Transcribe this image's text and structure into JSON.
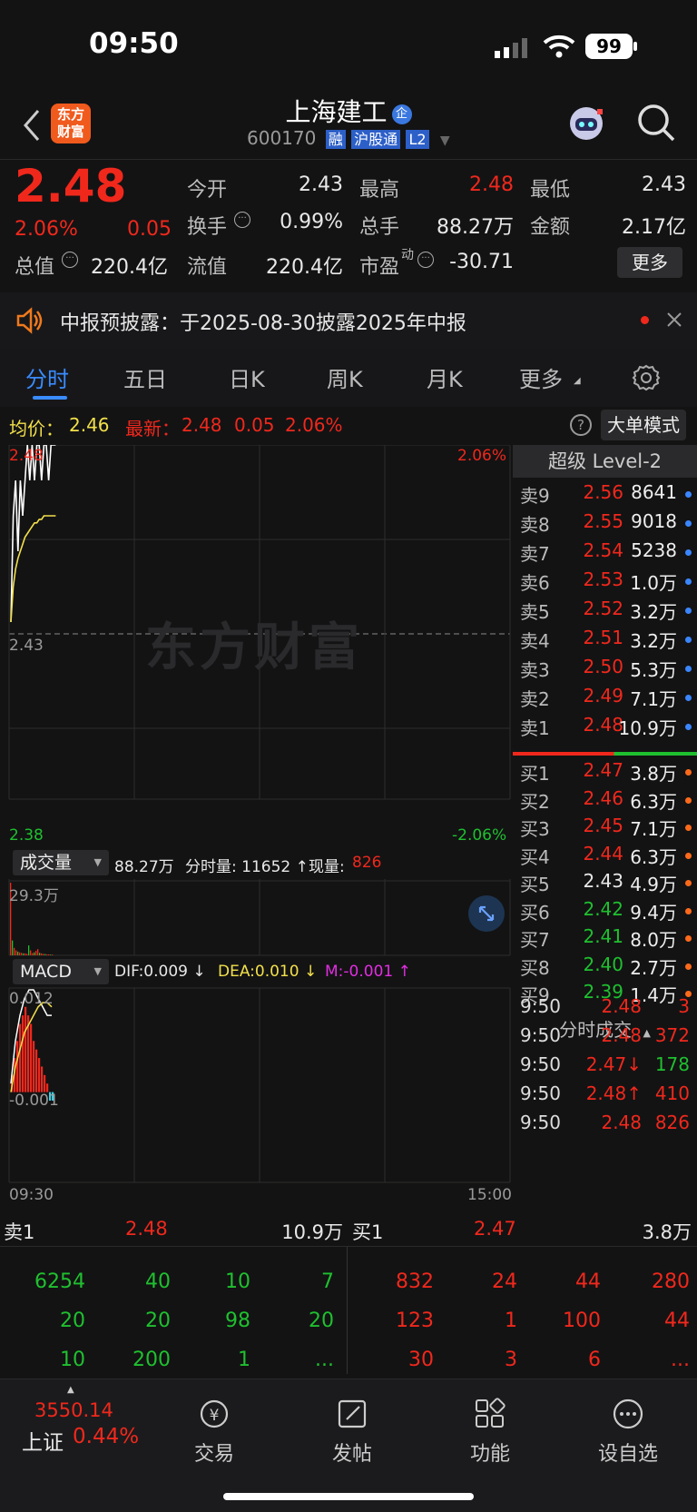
{
  "status_bar": {
    "time": "09:50",
    "battery": "99"
  },
  "header": {
    "logo_text_1": "东方",
    "logo_text_2": "财富",
    "stock_name": "上海建工",
    "badge_qi": "企",
    "stock_code": "600170",
    "tags": [
      "融",
      "沪股通",
      "L2"
    ]
  },
  "quote": {
    "price": "2.48",
    "change_pct": "2.06%",
    "change": "0.05",
    "fields": [
      {
        "k": "今开",
        "v": "2.43"
      },
      {
        "k": "最高",
        "v": "2.48"
      },
      {
        "k": "最低",
        "v": "2.43"
      },
      {
        "k": "换手",
        "v": "0.99%"
      },
      {
        "k": "总手",
        "v": "88.27万"
      },
      {
        "k": "金额",
        "v": "2.17亿"
      },
      {
        "k": "总值",
        "v": "220.4亿"
      },
      {
        "k": "流值",
        "v": "220.4亿"
      },
      {
        "k": "市盈",
        "v": "-30.71"
      }
    ],
    "pe_superscript": "动",
    "more_button": "更多"
  },
  "notice": {
    "text": "中报预披露：于2025-08-30披露2025年中报"
  },
  "tabs": [
    "分时",
    "五日",
    "日K",
    "周K",
    "月K",
    "更多"
  ],
  "info_bar": {
    "avg_label": "均价：",
    "avg_value": "2.46",
    "latest_label": "最新：",
    "latest_price": "2.48",
    "latest_change": "0.05",
    "latest_pct": "2.06%",
    "big_order_button": "大单模式"
  },
  "chart_labels": {
    "top_left": "2.48",
    "top_right": "2.06%",
    "mid_left": "2.43",
    "bottom_left": "2.38",
    "bottom_right": "-2.06%",
    "watermark": "东方财富",
    "volume_selector": "成交量",
    "volume_total": "88.27万",
    "volume_fen_label": "分时量: 11652 ↑",
    "volume_now_label": "现量:",
    "volume_now_value": "826",
    "volume_max": "29.3万",
    "macd_selector": "MACD",
    "dif": "DIF:0.009 ↓",
    "dea": "DEA:0.010 ↓",
    "m": "M:-0.001 ↑",
    "macd_top": "0.012",
    "macd_bottom": "-0.001",
    "time_start": "09:30",
    "time_end": "15:00"
  },
  "chart_data": {
    "type": "line",
    "ylim": [
      2.38,
      2.48
    ],
    "price_series": [
      2.43,
      2.46,
      2.47,
      2.45,
      2.47,
      2.46,
      2.47,
      2.48,
      2.47,
      2.48,
      2.47,
      2.48,
      2.48,
      2.47,
      2.48,
      2.48,
      2.47,
      2.48,
      2.48,
      2.48
    ],
    "avg_series": [
      2.43,
      2.44,
      2.445,
      2.448,
      2.45,
      2.452,
      2.454,
      2.455,
      2.456,
      2.457,
      2.458,
      2.458,
      2.459,
      2.459,
      2.46,
      2.46,
      2.46,
      2.46,
      2.46,
      2.46
    ],
    "volume_max": 293000,
    "volumes": [
      293000,
      60000,
      30000,
      20000,
      15000,
      12000,
      10000,
      8000,
      8000,
      6000,
      40000,
      20000,
      9000,
      12000,
      18000,
      25000,
      10000,
      8000,
      6000,
      5000,
      4000,
      4000,
      3000,
      3000
    ],
    "macd_ylim": [
      -0.001,
      0.012
    ],
    "macd_bars": [
      0.002,
      0.004,
      0.006,
      0.008,
      0.009,
      0.01,
      0.009,
      0.008,
      0.006,
      0.005,
      0.004,
      0.003,
      0.002,
      0.001,
      -0.001,
      -0.001
    ],
    "dif_series": [
      0.001,
      0.006,
      0.009,
      0.011,
      0.012,
      0.012,
      0.011,
      0.01,
      0.009,
      0.009
    ],
    "dea_series": [
      0.0,
      0.003,
      0.005,
      0.007,
      0.008,
      0.009,
      0.01,
      0.0105,
      0.0105,
      0.01
    ]
  },
  "level2": {
    "title": "超级 Level-2",
    "asks": [
      {
        "k": "卖9",
        "p": "2.56",
        "v": "8641",
        "pc": "red"
      },
      {
        "k": "卖8",
        "p": "2.55",
        "v": "9018",
        "pc": "red"
      },
      {
        "k": "卖7",
        "p": "2.54",
        "v": "5238",
        "pc": "red"
      },
      {
        "k": "卖6",
        "p": "2.53",
        "v": "1.0万",
        "pc": "red"
      },
      {
        "k": "卖5",
        "p": "2.52",
        "v": "3.2万",
        "pc": "red"
      },
      {
        "k": "卖4",
        "p": "2.51",
        "v": "3.2万",
        "pc": "red"
      },
      {
        "k": "卖3",
        "p": "2.50",
        "v": "5.3万",
        "pc": "red"
      },
      {
        "k": "卖2",
        "p": "2.49",
        "v": "7.1万",
        "pc": "red"
      },
      {
        "k": "卖1",
        "p": "2.48",
        "v": "10.9万",
        "pc": "red"
      }
    ],
    "bids": [
      {
        "k": "买1",
        "p": "2.47",
        "v": "3.8万",
        "pc": "red"
      },
      {
        "k": "买2",
        "p": "2.46",
        "v": "6.3万",
        "pc": "red"
      },
      {
        "k": "买3",
        "p": "2.45",
        "v": "7.1万",
        "pc": "red"
      },
      {
        "k": "买4",
        "p": "2.44",
        "v": "6.3万",
        "pc": "red"
      },
      {
        "k": "买5",
        "p": "2.43",
        "v": "4.9万",
        "pc": "white"
      },
      {
        "k": "买6",
        "p": "2.42",
        "v": "9.4万",
        "pc": "green"
      },
      {
        "k": "买7",
        "p": "2.41",
        "v": "8.0万",
        "pc": "green"
      },
      {
        "k": "买8",
        "p": "2.40",
        "v": "2.7万",
        "pc": "green"
      },
      {
        "k": "买9",
        "p": "2.39",
        "v": "1.4万",
        "pc": "green"
      }
    ],
    "trades_title": "分时成交",
    "trades": [
      {
        "t": "9:50",
        "p": "2.48",
        "v": "3"
      },
      {
        "t": "9:50",
        "p": "2.48",
        "v": "372"
      },
      {
        "t": "9:50",
        "p": "2.47↓",
        "v": "178",
        "vc": "green"
      },
      {
        "t": "9:50",
        "p": "2.48↑",
        "v": "410"
      },
      {
        "t": "9:50",
        "p": "2.48",
        "v": "826"
      }
    ]
  },
  "queue": {
    "sell_label": "卖1",
    "sell_price": "2.48",
    "sell_volume": "10.9万",
    "buy_label": "买1",
    "buy_price": "2.47",
    "buy_volume": "3.8万",
    "sell_rows": [
      [
        "6254",
        "40",
        "10",
        "7"
      ],
      [
        "20",
        "20",
        "98",
        "20"
      ],
      [
        "10",
        "200",
        "1",
        "..."
      ]
    ],
    "buy_rows": [
      [
        "832",
        "24",
        "44",
        "280"
      ],
      [
        "123",
        "1",
        "100",
        "44"
      ],
      [
        "30",
        "3",
        "6",
        "..."
      ]
    ]
  },
  "bottom_nav": {
    "index_value": "3550.14",
    "index_name": "上证",
    "index_pct": "0.44%",
    "items": [
      "交易",
      "发帖",
      "功能",
      "设自选"
    ]
  },
  "colors": {
    "red": "#f0281c",
    "green": "#1fc02f",
    "yellow": "#f2e04a",
    "blue": "#3a86ff",
    "orange": "#ff6a1a"
  }
}
